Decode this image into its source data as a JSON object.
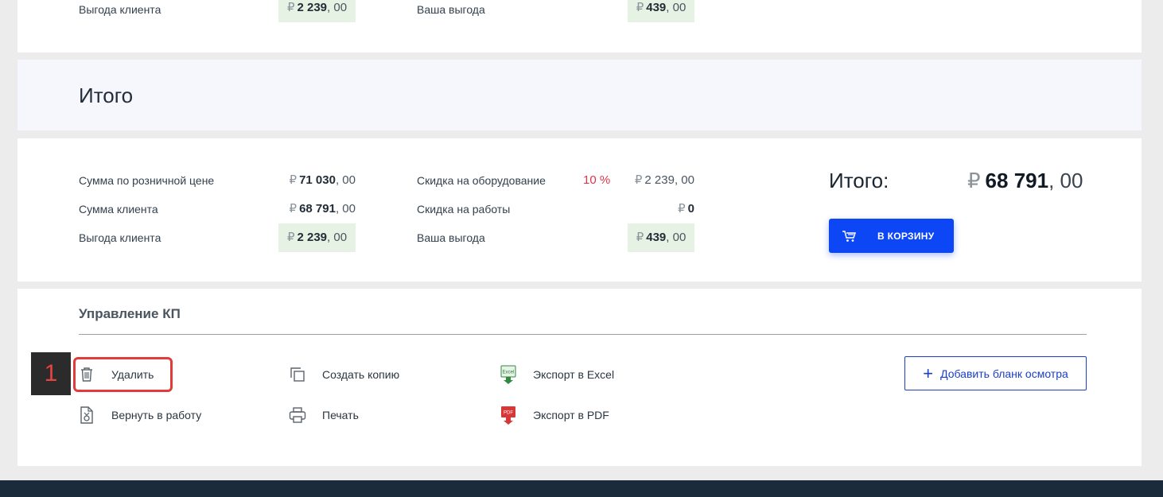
{
  "top_partial": {
    "client_benefit_label": "Выгода клиента",
    "client_benefit_value": {
      "currency": "₽",
      "integer": "2 239",
      "decimal": ", 00"
    },
    "your_benefit_label": "Ваша выгода",
    "your_benefit_value": {
      "currency": "₽",
      "integer": "439",
      "decimal": ", 00"
    }
  },
  "section": {
    "title": "Итого"
  },
  "summary": {
    "retail_sum_label": "Сумма по розничной цене",
    "retail_sum": {
      "currency": "₽",
      "integer": "71 030",
      "decimal": ", 00"
    },
    "client_sum_label": "Сумма клиента",
    "client_sum": {
      "currency": "₽",
      "integer": "68 791",
      "decimal": ", 00"
    },
    "client_benefit_label": "Выгода клиента",
    "client_benefit": {
      "currency": "₽",
      "integer": "2 239",
      "decimal": ", 00"
    },
    "equipment_discount_label": "Скидка на оборудование",
    "equipment_discount_percent": "10 %",
    "equipment_discount": {
      "currency": "₽",
      "integer": "2 239",
      "decimal": ", 00"
    },
    "work_discount_label": "Скидка на работы",
    "work_discount": {
      "currency": "₽",
      "integer": "0"
    },
    "your_benefit_label": "Ваша выгода",
    "your_benefit": {
      "currency": "₽",
      "integer": "439",
      "decimal": ", 00"
    },
    "total_label": "Итого:",
    "total": {
      "currency": "₽",
      "integer": "68 791",
      "decimal": ", 00"
    },
    "cart_button": "В КОРЗИНУ"
  },
  "manage": {
    "title": "Управление КП",
    "step_badge": "1",
    "actions": {
      "delete": "Удалить",
      "restore": "Вернуть в работу",
      "copy": "Создать копию",
      "print": "Печать",
      "export_excel": "Экспорт в Excel",
      "export_pdf": "Экспорт в PDF"
    },
    "excel_icon_text": "Excel",
    "pdf_icon_text": "PDF",
    "add_inspection_button": "Добавить бланк осмотра"
  },
  "colors": {
    "primary_blue": "#0d47f5",
    "outline_blue": "#1b3fc6",
    "highlight_red": "#e23b3b",
    "discount_red": "#e0334a",
    "benefit_green_bg": "#e5f2e4",
    "footer_dark": "#1c2b3b"
  }
}
